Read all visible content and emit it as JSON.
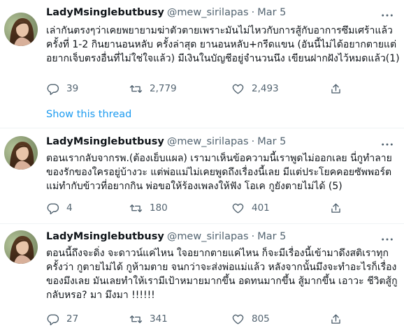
{
  "colors": {
    "link": "#1d9bf0",
    "secondary_text": "#536471",
    "primary_text": "#0f1419",
    "divider": "#eff3f4"
  },
  "tweets": [
    {
      "name": "LadyMsinglebutbusy",
      "handle": "@mew_sirilapas",
      "separator": "·",
      "date": "Mar 5",
      "text": "เล่ากันตรงๆว่าเคยพยายามฆ่าตัวตายเพราะมันไม่ไหวกับการสู้กับอาการซึมเศร้าแล้ว\nครั้งที่ 1-2 กินยานอนหลับ ครั้งล่าสุด ยานอนหลับ+กรีดแขน (อันนี้ไม่ได้อยากตายแต่\nอยากเจ็บตรงอื่นที่ไม่ใช่ใจแล้ว) มีเงินในบัญชีอยู่จำนวนนึง เขียนฝากฝังไว้หมดแล้ว(1)",
      "replies": "39",
      "retweets": "2,779",
      "likes": "2,493"
    },
    {
      "name": "LadyMsinglebutbusy",
      "handle": "@mew_sirilapas",
      "separator": "·",
      "date": "Mar 5",
      "text": "ตอนเรากลับจากรพ.(ต้องเย็บแผล) เรามาเห็นข้อความนี้เราพูดไม่ออกเลย นี่กูทำลาย\nของรักของใครอยู่บ้างวะ แต่พ่อแม่ไม่เคยพูดถึงเรื่องนี้เลย มีแต่ประโยคคอยซัพพอร์ต\nแม่ทำกับข้าวที่อยากกิน พ่อขอให้ร้องเพลงให้ฟัง โอเค กูยังตายไม่ได้ (5)",
      "replies": "4",
      "retweets": "180",
      "likes": "401"
    },
    {
      "name": "LadyMsinglebutbusy",
      "handle": "@mew_sirilapas",
      "separator": "·",
      "date": "Mar 5",
      "text": "ตอนนี้ถึงจะดิ่ง จะดาวน์แค่ไหน ใจอยากตายแค่ไหน ก็จะมีเรื่องนี้เข้ามาดึงสติเราทุก\nครั้งว่า กูตายไม่ได้ กูห้ามตาย จนกว่าจะส่งพ่อแม่แล้ว หลังจากนั้นมึงจะทำอะไรก็เรื่อง\nของมึงเลย มันเลยทำให้เรามีเป้าหมายมากขึ้น อดทนมากขึ้น สู้มากขึ้น เอาวะ ชีวิตสู้กู\nกลับหรอ? มา มึงมา !!!!!!",
      "replies": "27",
      "retweets": "341",
      "likes": "805"
    }
  ],
  "show_thread_label": "Show this thread",
  "icons": {
    "avatar": "profile-photo",
    "more": "more-horizontal-icon",
    "reply": "reply-bubble-icon",
    "retweet": "retweet-arrows-icon",
    "like": "heart-outline-icon",
    "share": "share-upload-icon"
  }
}
